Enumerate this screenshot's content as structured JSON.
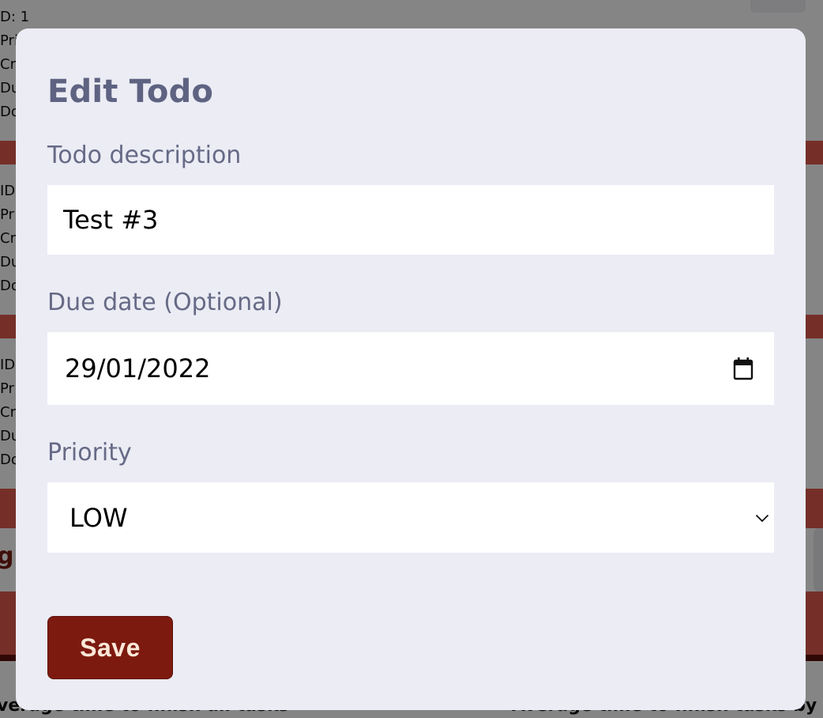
{
  "background": {
    "card_lines": [
      [
        "D: 1",
        "Pri",
        "Cre",
        "Du",
        "Do"
      ],
      [
        "ID",
        "Pr",
        "Cr",
        "Du",
        "Do"
      ],
      [
        "ID",
        "Pr",
        "Cr",
        "Du",
        "Do"
      ]
    ],
    "heading_fragment": "g",
    "bottom_left_text": "verage time to finish all tasks",
    "bottom_right_text": "Average time to finish tasks by pr"
  },
  "modal": {
    "title": "Edit Todo",
    "description": {
      "label": "Todo description",
      "value": "Test #3"
    },
    "due_date": {
      "label": "Due date (Optional)",
      "value": "29/01/2022"
    },
    "priority": {
      "label": "Priority",
      "value": "LOW"
    },
    "save_label": "Save"
  },
  "colors": {
    "modal_bg": "#ebecf4",
    "title": "#5f6382",
    "label": "#666a86",
    "save_bg": "#7d1a10",
    "save_text": "#fbe8d8"
  },
  "icons": {
    "date_picker": "calendar-icon",
    "select": "chevron-down-icon"
  }
}
